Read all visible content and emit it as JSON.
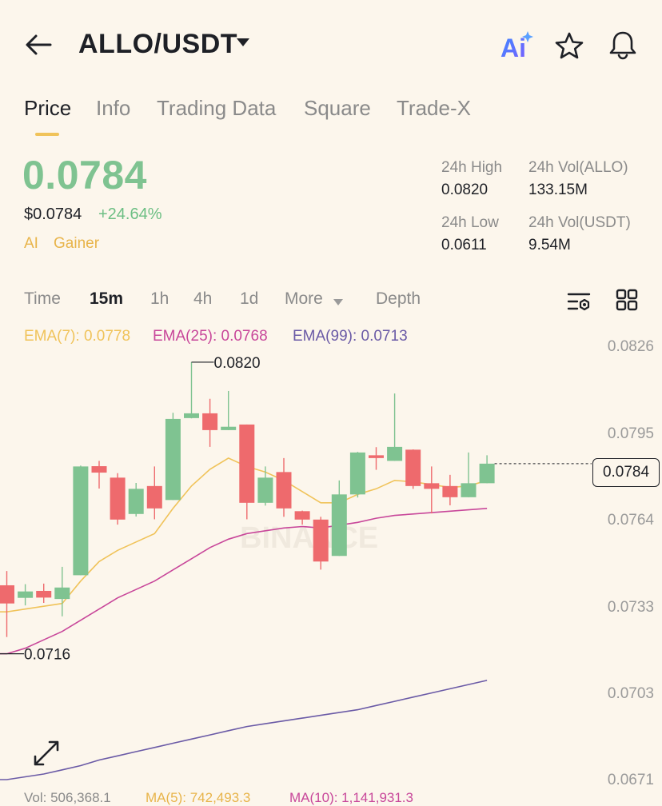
{
  "header": {
    "title": "ALLO/USDT",
    "ai_label": "Ai"
  },
  "tabs": [
    {
      "label": "Price",
      "active": true
    },
    {
      "label": "Info"
    },
    {
      "label": "Trading Data"
    },
    {
      "label": "Square"
    },
    {
      "label": "Trade-X"
    }
  ],
  "price": {
    "last": "0.0784",
    "fiat": "$0.0784",
    "change": "+24.64%",
    "tags": [
      "AI",
      "Gainer"
    ]
  },
  "stats": {
    "high_label": "24h High",
    "high": "0.0820",
    "low_label": "24h Low",
    "low": "0.0611",
    "vol_base_label": "24h Vol(ALLO)",
    "vol_base": "133.15M",
    "vol_quote_label": "24h Vol(USDT)",
    "vol_quote": "9.54M"
  },
  "timeframes": [
    "Time",
    "15m",
    "1h",
    "4h",
    "1d",
    "More",
    "Depth"
  ],
  "active_timeframe": "15m",
  "ema": {
    "ema7": "EMA(7): 0.0778",
    "ema25": "EMA(25): 0.0768",
    "ema99": "EMA(99): 0.0713"
  },
  "colors": {
    "up": "#7fc391",
    "down": "#ee6a6d",
    "ema7": "#f0c35a",
    "ema25": "#c8479a",
    "ema99": "#6a5aa6",
    "accent": "#f0c35a",
    "ai_gradient_start": "#3d8bff",
    "ai_gradient_end": "#7b5cff"
  },
  "icons": [
    "back-arrow-icon",
    "dropdown-caret-icon",
    "ai-icon",
    "star-icon",
    "bell-icon",
    "chart-settings-icon",
    "grid-layout-icon",
    "expand-icon"
  ],
  "chart_data": {
    "type": "candlestick",
    "y_ticks": [
      "0.0826",
      "0.0795",
      "0.0764",
      "0.0733",
      "0.0703",
      "0.0671"
    ],
    "ylim": [
      0.0671,
      0.0826
    ],
    "current_price_label": "0.0784",
    "high_marker": "0.0820",
    "low_marker": "0.0716",
    "candles": [
      {
        "o": 0.07405,
        "h": 0.07456,
        "l": 0.0722,
        "c": 0.0734
      },
      {
        "o": 0.0736,
        "h": 0.07409,
        "l": 0.07333,
        "c": 0.07383
      },
      {
        "o": 0.07385,
        "h": 0.07411,
        "l": 0.07342,
        "c": 0.07361
      },
      {
        "o": 0.07356,
        "h": 0.07471,
        "l": 0.07294,
        "c": 0.07397
      },
      {
        "o": 0.07441,
        "h": 0.07833,
        "l": 0.07441,
        "c": 0.0783
      },
      {
        "o": 0.07831,
        "h": 0.0785,
        "l": 0.07751,
        "c": 0.07808
      },
      {
        "o": 0.0779,
        "h": 0.07806,
        "l": 0.07622,
        "c": 0.0764
      },
      {
        "o": 0.0766,
        "h": 0.07771,
        "l": 0.07651,
        "c": 0.0775
      },
      {
        "o": 0.0776,
        "h": 0.0783,
        "l": 0.07641,
        "c": 0.0768
      },
      {
        "o": 0.0771,
        "h": 0.08022,
        "l": 0.0771,
        "c": 0.08
      },
      {
        "o": 0.08003,
        "h": 0.08203,
        "l": 0.08002,
        "c": 0.0802
      },
      {
        "o": 0.0802,
        "h": 0.08072,
        "l": 0.079,
        "c": 0.0796
      },
      {
        "o": 0.0796,
        "h": 0.081,
        "l": 0.0796,
        "c": 0.07972
      },
      {
        "o": 0.0798,
        "h": 0.0798,
        "l": 0.07641,
        "c": 0.077
      },
      {
        "o": 0.077,
        "h": 0.0783,
        "l": 0.0769,
        "c": 0.0779
      },
      {
        "o": 0.0781,
        "h": 0.0786,
        "l": 0.0765,
        "c": 0.0768
      },
      {
        "o": 0.0767,
        "h": 0.07672,
        "l": 0.07622,
        "c": 0.0764
      },
      {
        "o": 0.0764,
        "h": 0.0765,
        "l": 0.07461,
        "c": 0.0749
      },
      {
        "o": 0.0751,
        "h": 0.0778,
        "l": 0.0751,
        "c": 0.0773
      },
      {
        "o": 0.0773,
        "h": 0.07882,
        "l": 0.07719,
        "c": 0.0788
      },
      {
        "o": 0.0787,
        "h": 0.07899,
        "l": 0.07818,
        "c": 0.0786
      },
      {
        "o": 0.0785,
        "h": 0.08091,
        "l": 0.0785,
        "c": 0.079
      },
      {
        "o": 0.0789,
        "h": 0.07891,
        "l": 0.0775,
        "c": 0.0776
      },
      {
        "o": 0.0777,
        "h": 0.0783,
        "l": 0.07662,
        "c": 0.0775
      },
      {
        "o": 0.0776,
        "h": 0.078,
        "l": 0.07691,
        "c": 0.0772
      },
      {
        "o": 0.0772,
        "h": 0.0788,
        "l": 0.0772,
        "c": 0.0777
      },
      {
        "o": 0.0777,
        "h": 0.0787,
        "l": 0.0777,
        "c": 0.0784
      }
    ],
    "series": [
      {
        "name": "EMA(7)",
        "values": [
          0.0731,
          0.0732,
          0.0733,
          0.0734,
          0.0742,
          0.0749,
          0.0753,
          0.0756,
          0.0759,
          0.0768,
          0.0776,
          0.0782,
          0.0786,
          0.0783,
          0.0781,
          0.0778,
          0.0774,
          0.077,
          0.077,
          0.0773,
          0.0775,
          0.0778,
          0.07775,
          0.07765,
          0.07755,
          0.0776,
          0.0778
        ]
      },
      {
        "name": "EMA(25)",
        "values": [
          0.0716,
          0.0718,
          0.0721,
          0.0724,
          0.0728,
          0.0732,
          0.0736,
          0.0739,
          0.0742,
          0.0746,
          0.075,
          0.0754,
          0.0757,
          0.0759,
          0.076,
          0.0761,
          0.07615,
          0.0761,
          0.0762,
          0.0763,
          0.07645,
          0.07655,
          0.0766,
          0.07665,
          0.0767,
          0.07675,
          0.0768
        ]
      },
      {
        "name": "EMA(99)",
        "values": [
          0.0671,
          0.0672,
          0.0673,
          0.06745,
          0.0676,
          0.0678,
          0.06795,
          0.0681,
          0.06825,
          0.0684,
          0.06855,
          0.0687,
          0.06885,
          0.069,
          0.0691,
          0.0692,
          0.0693,
          0.0694,
          0.0695,
          0.0696,
          0.06975,
          0.0699,
          0.07005,
          0.0702,
          0.07035,
          0.0705,
          0.07065
        ]
      }
    ]
  },
  "footer": {
    "vol": "Vol: 506,368.1",
    "ma5": "MA(5): 742,493.3",
    "ma10": "MA(10): 1,141,931.3"
  }
}
